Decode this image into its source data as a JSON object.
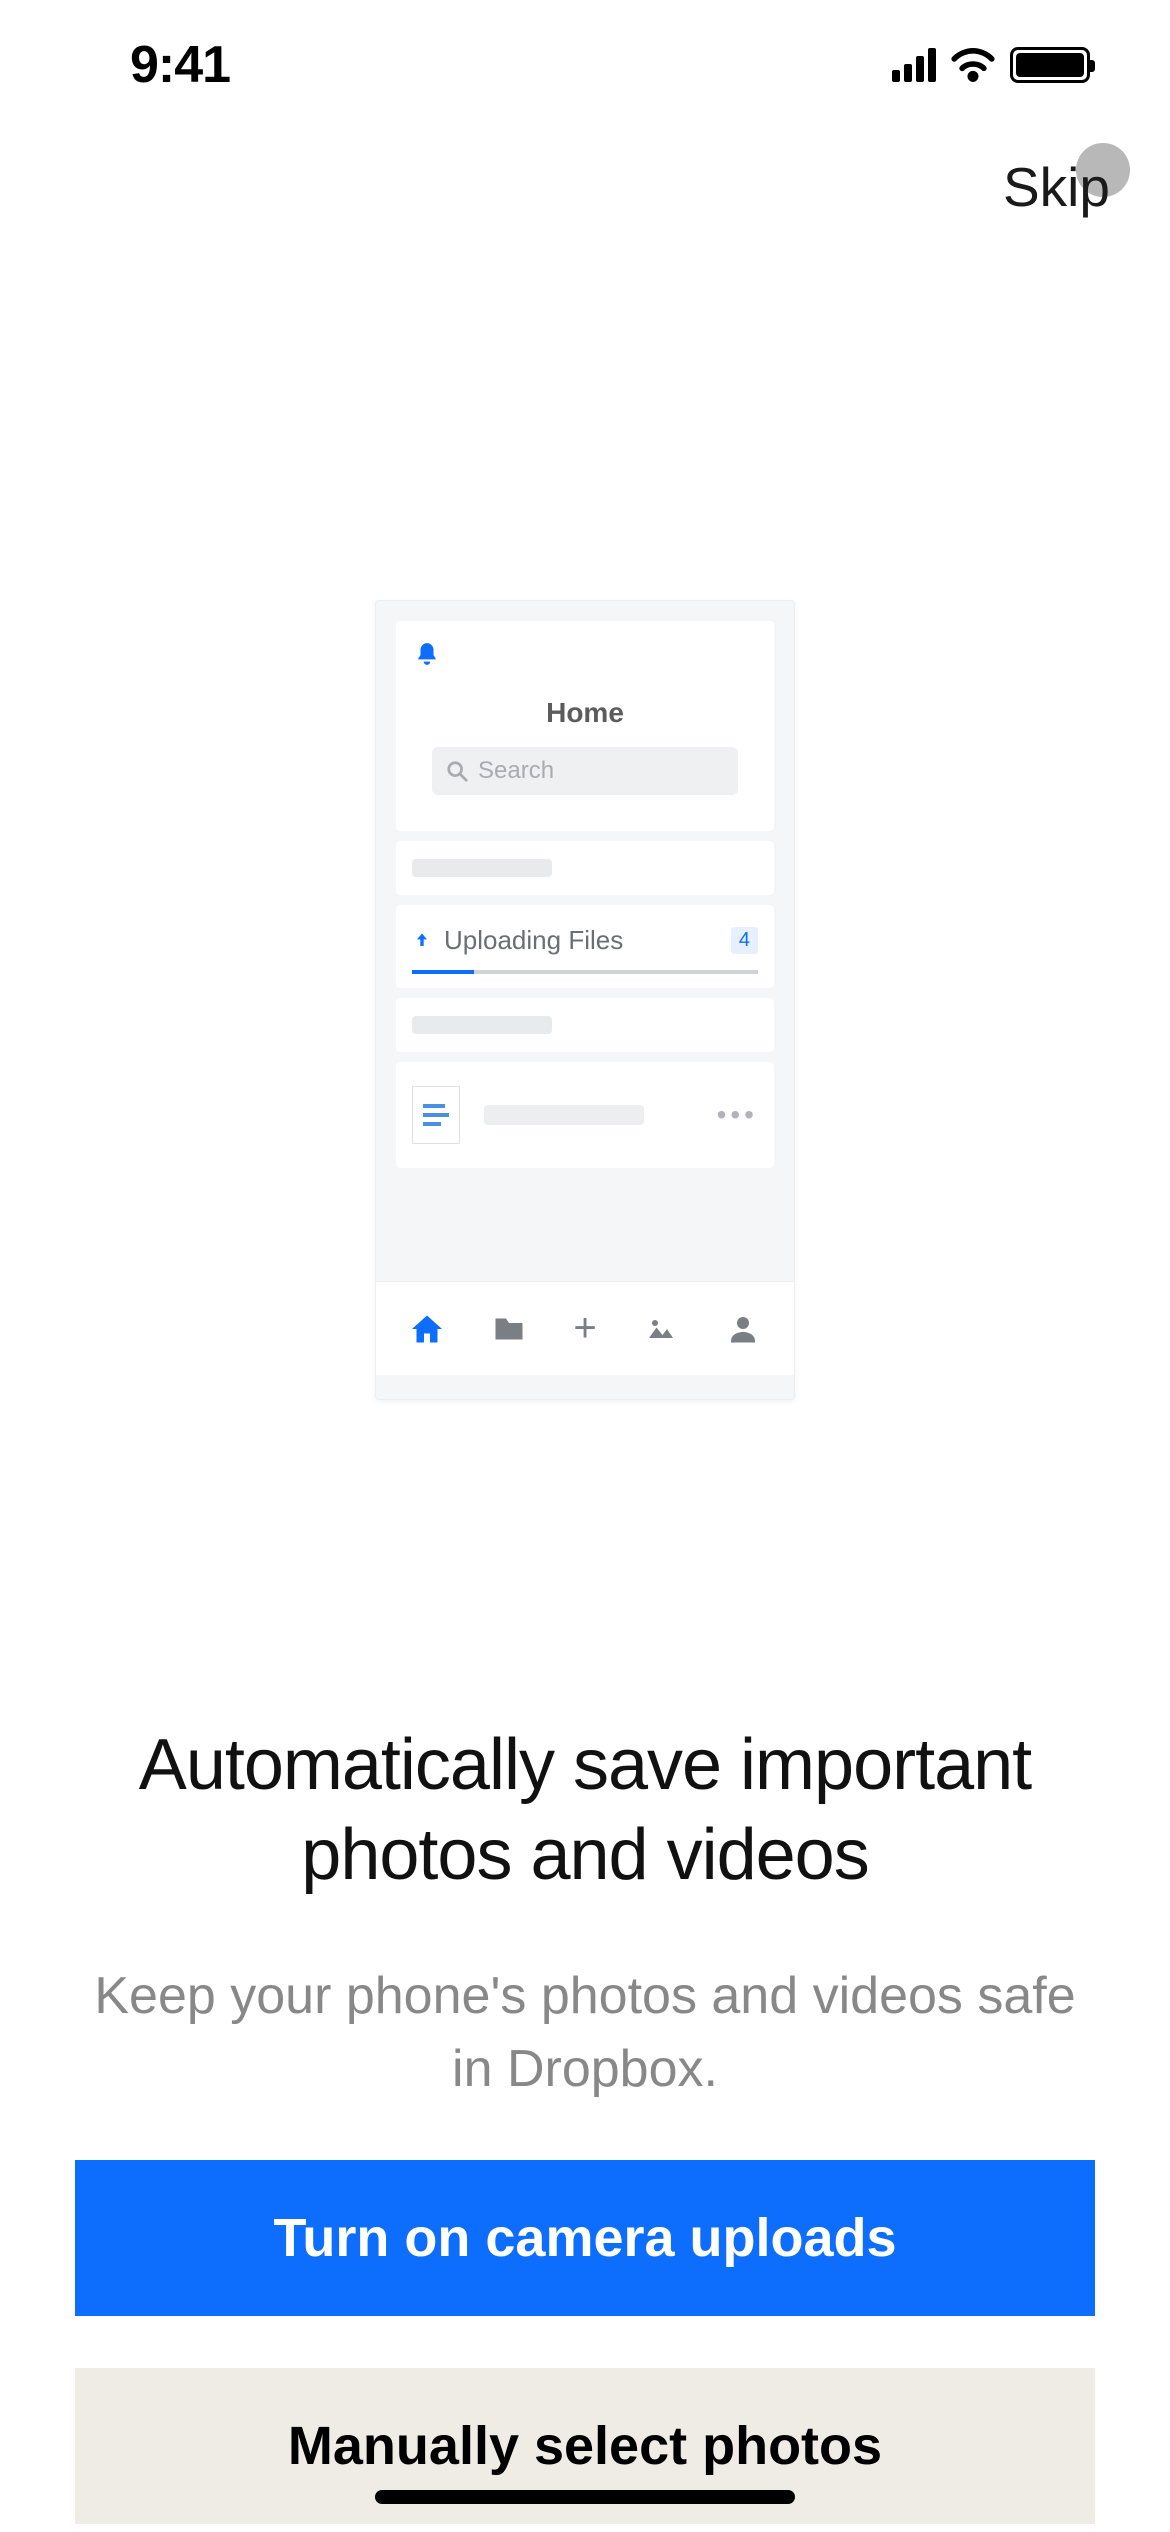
{
  "status": {
    "time": "9:41"
  },
  "skip": {
    "label": "Skip"
  },
  "mockup": {
    "home_title": "Home",
    "search_placeholder": "Search",
    "uploading_label": "Uploading Files",
    "uploading_count": "4"
  },
  "headline": "Automatically save important photos and videos",
  "subline": "Keep your phone's photos and videos safe in Dropbox.",
  "buttons": {
    "primary": "Turn on camera uploads",
    "secondary": "Manually select photos"
  }
}
